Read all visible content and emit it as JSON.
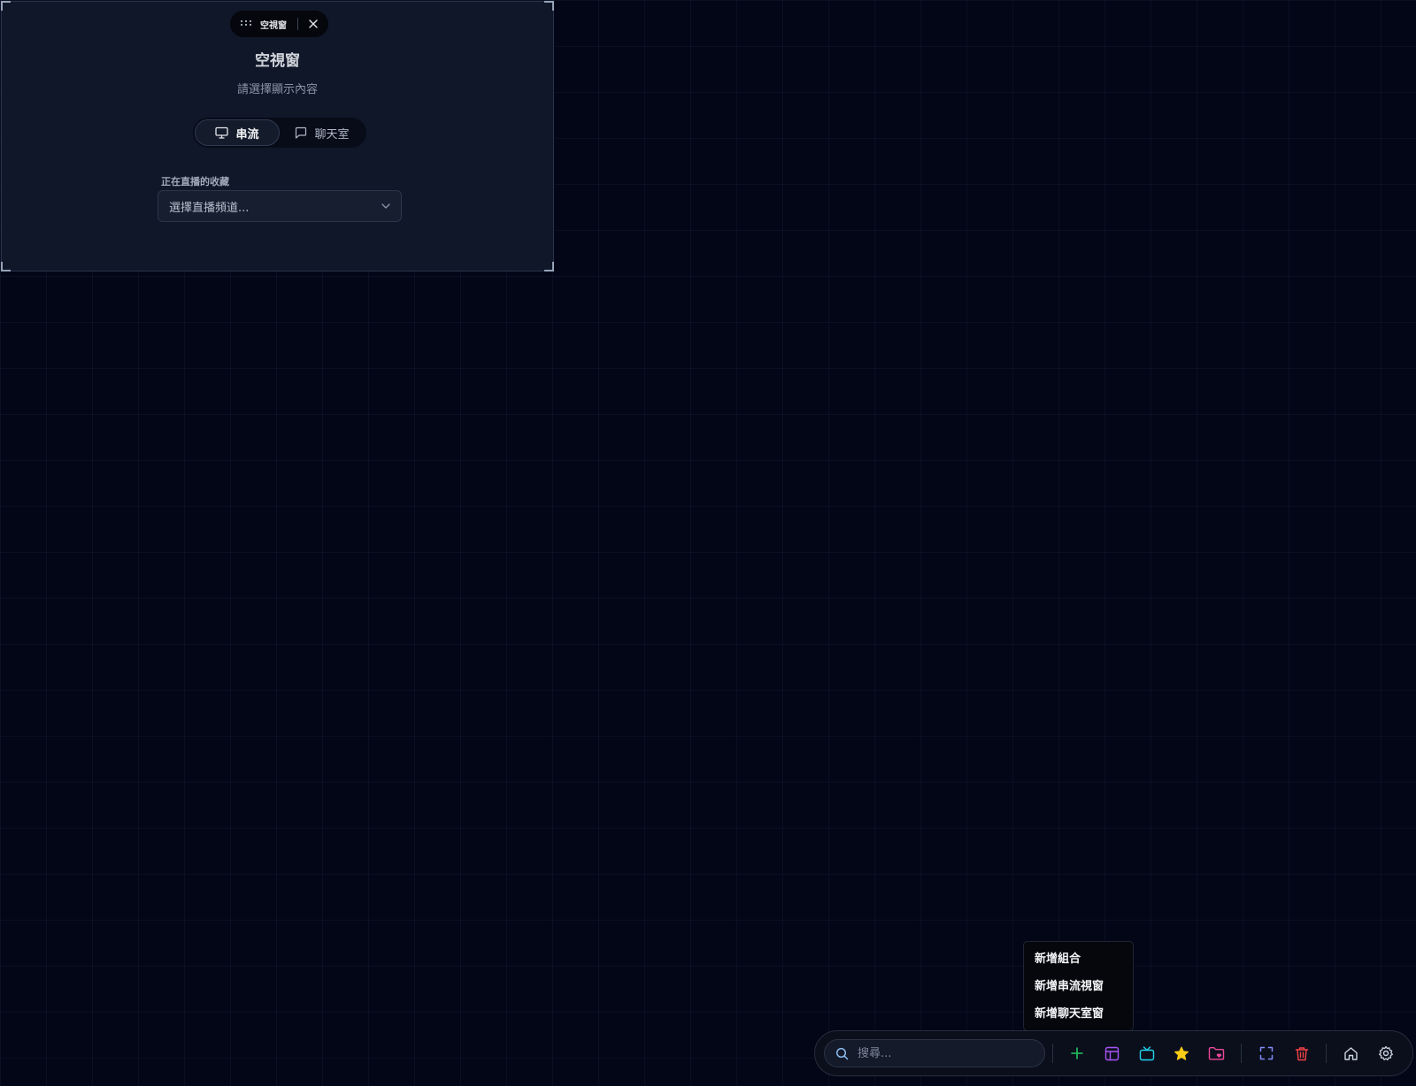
{
  "panel": {
    "pill_title": "空視窗",
    "heading": "空視窗",
    "subheading": "請選擇顯示內容",
    "tabs": [
      {
        "label": "串流",
        "icon": "monitor-icon",
        "active": true
      },
      {
        "label": "聊天室",
        "icon": "chat-bubble-icon",
        "active": false
      }
    ],
    "field_label": "正在直播的收藏",
    "select_placeholder": "選擇直播頻道..."
  },
  "menu": {
    "items": [
      {
        "label": "新增組合"
      },
      {
        "label": "新增串流視窗"
      },
      {
        "label": "新增聊天室窗"
      }
    ]
  },
  "toolbar": {
    "search_placeholder": "搜尋...",
    "buttons": [
      {
        "icon": "plus-icon",
        "color": "#22c55e"
      },
      {
        "icon": "layout-icon",
        "color": "#a855f7"
      },
      {
        "icon": "tv-icon",
        "color": "#22d3ee"
      },
      {
        "icon": "star-icon",
        "color": "#facc15"
      },
      {
        "icon": "folder-heart-icon",
        "color": "#ec4899"
      },
      {
        "icon": "fullscreen-icon",
        "color": "#818cf8"
      },
      {
        "icon": "trash-icon",
        "color": "#ef4444"
      },
      {
        "icon": "home-icon",
        "color": "#cbd5e1"
      },
      {
        "icon": "settings-icon",
        "color": "#cbd5e1"
      }
    ]
  },
  "colors": {
    "background": "#030616",
    "panel": "#0f1729"
  }
}
